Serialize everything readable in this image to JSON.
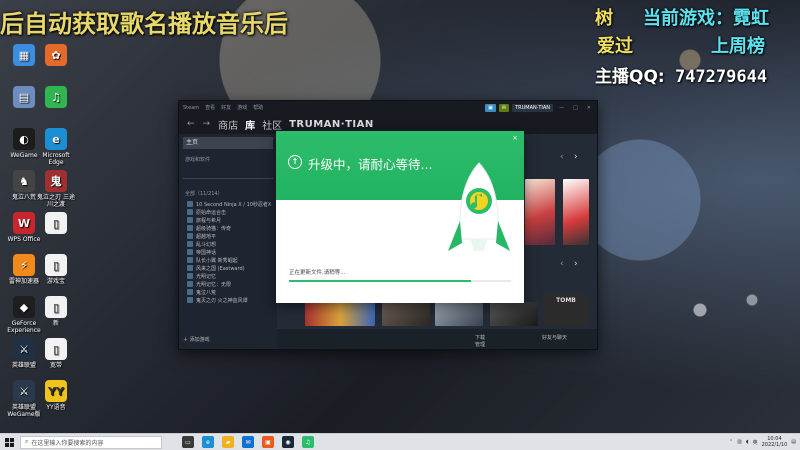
{
  "overlay": {
    "scroll_title": "后自动获取歌名播放音乐后",
    "row1_a": "树",
    "row1_b": "当前游戏：霓虹",
    "row2_a": "爱过",
    "row2_b": "上周榜",
    "qq_label": "主播QQ:",
    "qq_number": "747279644"
  },
  "desktop_icons": [
    {
      "label": "",
      "color": "#3b8de0",
      "glyph": "▦"
    },
    {
      "label": "",
      "color": "#e36a2b",
      "glyph": "✿"
    },
    {
      "label": "",
      "color": "#6c8ebf",
      "glyph": "▤"
    },
    {
      "label": "",
      "color": "#2fb650",
      "glyph": "♫"
    },
    {
      "label": "WeGame",
      "color": "#1c1c1c",
      "glyph": "◐"
    },
    {
      "label": "Microsoft Edge",
      "color": "#1b8fd1",
      "glyph": "e"
    },
    {
      "label": "鬼泣八荒",
      "color": "#444",
      "glyph": "♞"
    },
    {
      "label": "鬼泣之刃 三途川之渡",
      "color": "#a03030",
      "glyph": "鬼"
    },
    {
      "label": "WPS Office",
      "color": "#c9252c",
      "glyph": "W"
    },
    {
      "label": "",
      "color": "#f2f2f2",
      "glyph": "▯"
    },
    {
      "label": "雷神加速器",
      "color": "#f08a1c",
      "glyph": "⚡"
    },
    {
      "label": "游戏宝",
      "color": "#f2f2f2",
      "glyph": "▯"
    },
    {
      "label": "GeForce Experience",
      "color": "#1e1e1e",
      "glyph": "◆"
    },
    {
      "label": "新",
      "color": "#f2f2f2",
      "glyph": "▯"
    },
    {
      "label": "英雄联盟",
      "color": "#1f3142",
      "glyph": "⚔"
    },
    {
      "label": "宽带",
      "color": "#f2f2f2",
      "glyph": "▯"
    },
    {
      "label": "英雄联盟 WeGame版",
      "color": "#2b3a4a",
      "glyph": "⚔"
    },
    {
      "label": "YY语音",
      "color": "#f1c31f",
      "glyph": "YY"
    }
  ],
  "steam": {
    "top_menu": [
      "Steam",
      "查看",
      "好友",
      "游戏",
      "帮助"
    ],
    "nav_back": "←",
    "nav_forward": "→",
    "nav_store": "商店",
    "nav_library": "库",
    "nav_community": "社区",
    "nav_user": "TRUMAN·TIAN",
    "side_home": "主页",
    "side_filter": "游戏和软件",
    "side_section": "全部（11/214）",
    "games": [
      "10 Second Ninja X / 10秒忍者X",
      "原始命运合击",
      "旅程与希月",
      "超级骑猫：传奇",
      "超越地平",
      "乱斗幻想",
      "帝国神话",
      "队长小翼 新秀崛起",
      "风来之国 (Eastward)",
      "光明记忆",
      "光明记忆：无限",
      "鬼泣八荒",
      "鬼灭之刃 火之神血风谭"
    ],
    "side_add": "添加游戏",
    "footer_download": "下载",
    "footer_download_sub": "管理",
    "footer_friends": "好友与聊天",
    "tile_label": "TOMB"
  },
  "dialog": {
    "close": "×",
    "title": "升级中，请耐心等待...",
    "status": "正在更新文件,请稍等...",
    "progress": 0.82,
    "accent": "#2dbd6a"
  },
  "taskbar": {
    "search_placeholder": "在这里输入你要搜索的内容",
    "ime": "英",
    "time": "10:04",
    "date": "2022/1/10"
  }
}
